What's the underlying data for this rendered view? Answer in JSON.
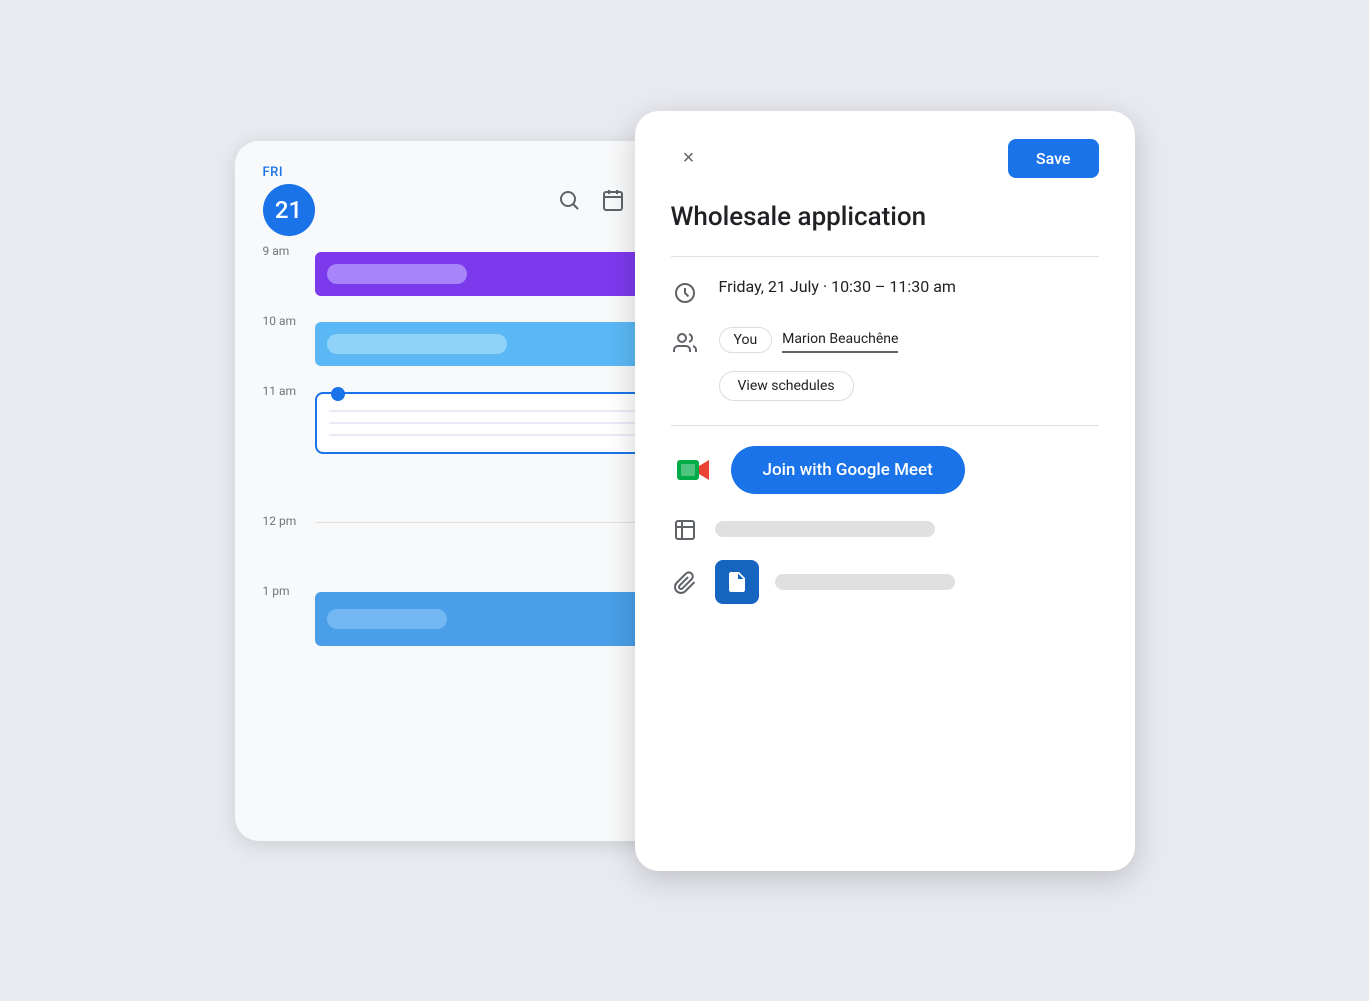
{
  "calendar": {
    "day_label": "FRI",
    "day_number": "21",
    "time_slots": [
      {
        "label": "9 am"
      },
      {
        "label": "10 am"
      },
      {
        "label": "11 am"
      },
      {
        "label": "12 pm"
      },
      {
        "label": "1 pm"
      }
    ]
  },
  "detail": {
    "close_label": "×",
    "save_label": "Save",
    "title": "Wholesale application",
    "datetime": "Friday, 21 July  ·  10:30 – 11:30 am",
    "attendees": [
      "You",
      "Marion Beauchêne"
    ],
    "view_schedules_label": "View schedules",
    "meet_button_label": "Join with Google Meet"
  }
}
